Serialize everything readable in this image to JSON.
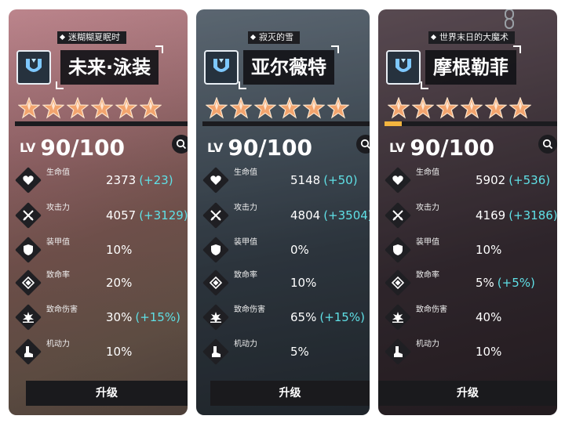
{
  "panels": [
    {
      "title_tag": "迷糊糊夏眠时",
      "name": "未来·泳装",
      "star_count": 6,
      "xp_fraction": 0.0,
      "level_prefix": "LV",
      "level": "90/100",
      "upgrade_label": "升级",
      "stats": [
        {
          "label": "生命值",
          "value": "2373",
          "bonus": "(+23)",
          "icon": "heart-icon"
        },
        {
          "label": "攻击力",
          "value": "4057",
          "bonus": "(+3129)",
          "icon": "crossed-swords-icon"
        },
        {
          "label": "装甲值",
          "value": "10%",
          "bonus": "",
          "icon": "shield-icon"
        },
        {
          "label": "致命率",
          "value": "20%",
          "bonus": "",
          "icon": "crit-rate-icon"
        },
        {
          "label": "致命伤害",
          "value": "30%",
          "bonus": "(+15%)",
          "icon": "explosion-icon"
        },
        {
          "label": "机动力",
          "value": "10%",
          "bonus": "",
          "icon": "boot-icon"
        }
      ]
    },
    {
      "title_tag": "寂灭的雪",
      "name": "亚尔薇特",
      "star_count": 6,
      "xp_fraction": 0.0,
      "level_prefix": "LV",
      "level": "90/100",
      "upgrade_label": "升级",
      "stats": [
        {
          "label": "生命值",
          "value": "5148",
          "bonus": "(+50)",
          "icon": "heart-icon"
        },
        {
          "label": "攻击力",
          "value": "4804",
          "bonus": "(+3504)",
          "icon": "crossed-swords-icon"
        },
        {
          "label": "装甲值",
          "value": "0%",
          "bonus": "",
          "icon": "shield-icon"
        },
        {
          "label": "致命率",
          "value": "10%",
          "bonus": "",
          "icon": "crit-rate-icon"
        },
        {
          "label": "致命伤害",
          "value": "65%",
          "bonus": "(+15%)",
          "icon": "explosion-icon"
        },
        {
          "label": "机动力",
          "value": "5%",
          "bonus": "",
          "icon": "boot-icon"
        }
      ]
    },
    {
      "title_tag": "世界末日的大魔术",
      "name": "摩根勒菲",
      "star_count": 6,
      "xp_fraction": 0.1,
      "level_prefix": "LV",
      "level": "90/100",
      "upgrade_label": "升级",
      "stats": [
        {
          "label": "生命值",
          "value": "5902",
          "bonus": "(+536)",
          "icon": "heart-icon"
        },
        {
          "label": "攻击力",
          "value": "4169",
          "bonus": "(+3186)",
          "icon": "crossed-swords-icon"
        },
        {
          "label": "装甲值",
          "value": "10%",
          "bonus": "",
          "icon": "shield-icon"
        },
        {
          "label": "致命率",
          "value": "5%",
          "bonus": "(+5%)",
          "icon": "crit-rate-icon"
        },
        {
          "label": "致命伤害",
          "value": "40%",
          "bonus": "",
          "icon": "explosion-icon"
        },
        {
          "label": "机动力",
          "value": "10%",
          "bonus": "",
          "icon": "boot-icon"
        }
      ]
    }
  ],
  "colors": {
    "bonus": "#5fe0e6",
    "xp_fill": "#f3b53f",
    "star": "#f2a46e"
  }
}
